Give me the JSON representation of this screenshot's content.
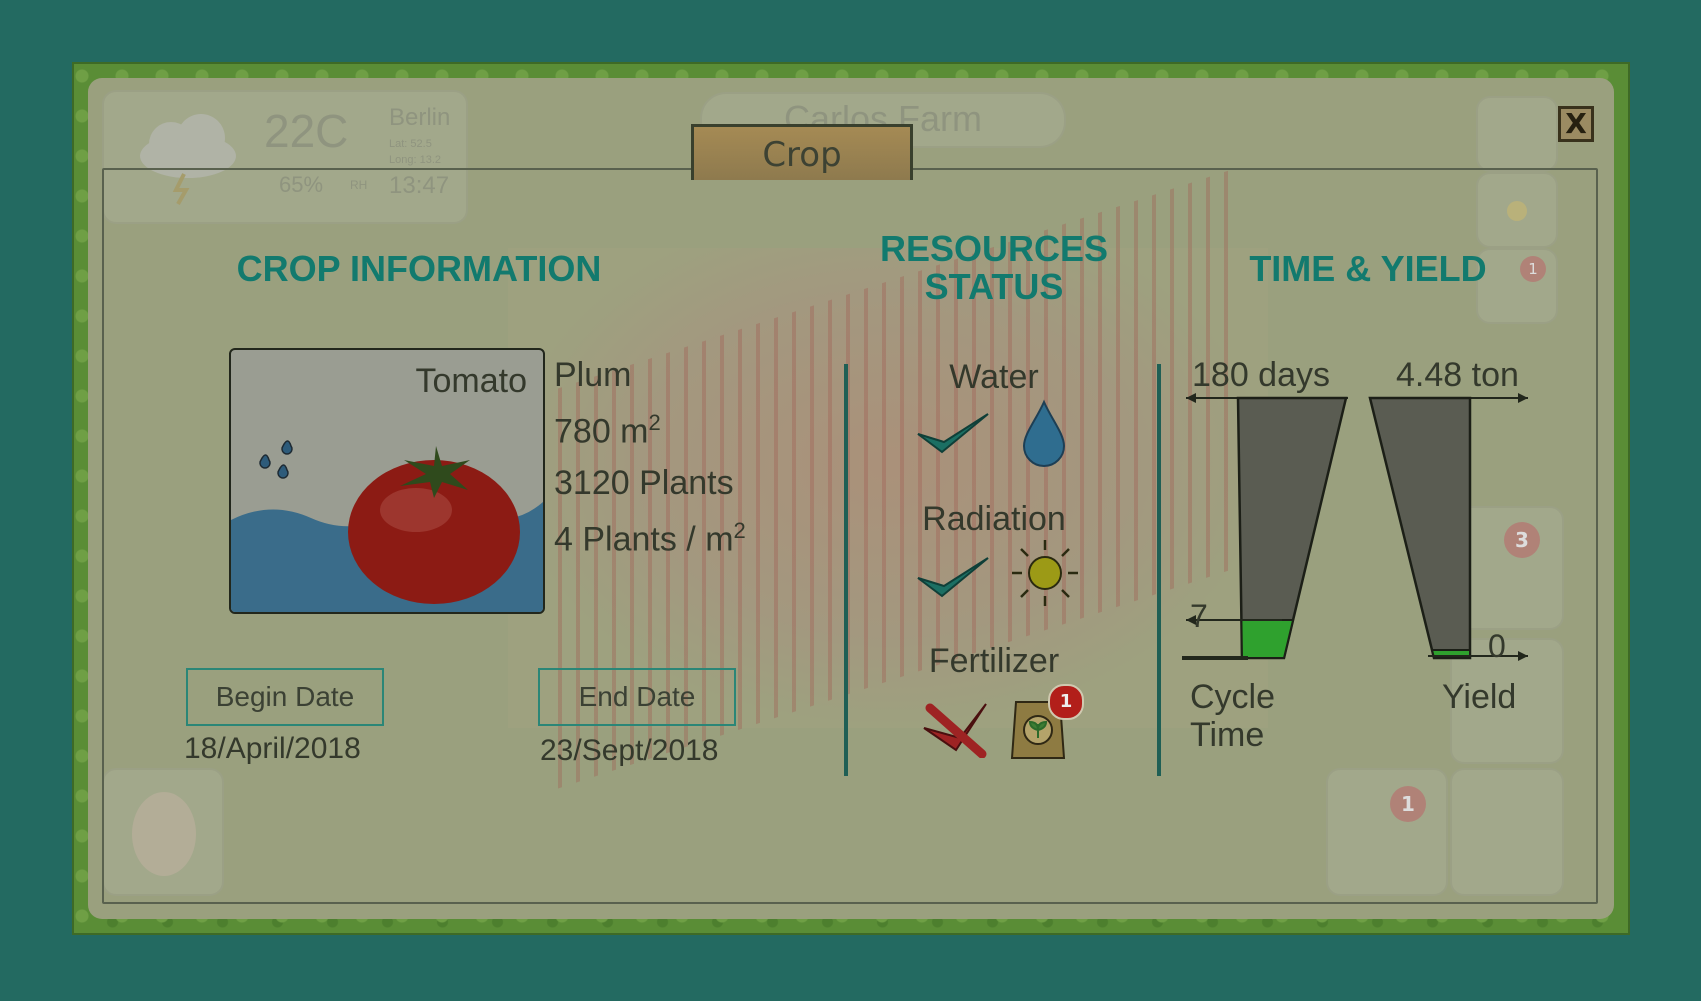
{
  "background_hud": {
    "temperature": "22C",
    "city": "Berlin",
    "lat": "Lat: 52.5",
    "long": "Long: 13.2",
    "humidity": "65%",
    "humidity_unit": "RH",
    "time": "13:47",
    "farm_name": "Carlos Farm",
    "alert_badge": "3",
    "fert_badge_small": "1",
    "worker_badge": "1"
  },
  "dialog": {
    "tab_title": "Crop",
    "close_label": "X"
  },
  "crop_info": {
    "heading": "CROP INFORMATION",
    "crop_name": "Tomato",
    "variety": "Plum",
    "area_value": "780 m",
    "area_sup": "2",
    "plants": "3120 Plants",
    "density_value": "4 Plants / m",
    "density_sup": "2",
    "begin_date_label": "Begin Date",
    "begin_date": "18/April/2018",
    "end_date_label": "End Date",
    "end_date": "23/Sept/2018"
  },
  "resources": {
    "heading_line1": "RESOURCES",
    "heading_line2": "STATUS",
    "items": [
      {
        "label": "Water",
        "ok": true,
        "icon": "water-drop-icon"
      },
      {
        "label": "Radiation",
        "ok": true,
        "icon": "sun-icon"
      },
      {
        "label": "Fertilizer",
        "ok": false,
        "icon": "fertilizer-bag-icon",
        "badge": "1"
      }
    ]
  },
  "time_yield": {
    "heading": "TIME & YIELD",
    "cycle_total": "180 days",
    "cycle_total_days": 180,
    "cycle_current": "7",
    "cycle_current_days": 7,
    "cycle_label_line1": "Cycle",
    "cycle_label_line2": "Time",
    "yield_total": "4.48 ton",
    "yield_total_ton": 4.48,
    "yield_current": "0",
    "yield_current_ton": 0,
    "yield_label": "Yield"
  },
  "colors": {
    "accent_teal": "#127a6e",
    "ok_check": "#1b6f63",
    "fail_cross": "#9e2323",
    "gauge_fill": "#2fa12e"
  }
}
